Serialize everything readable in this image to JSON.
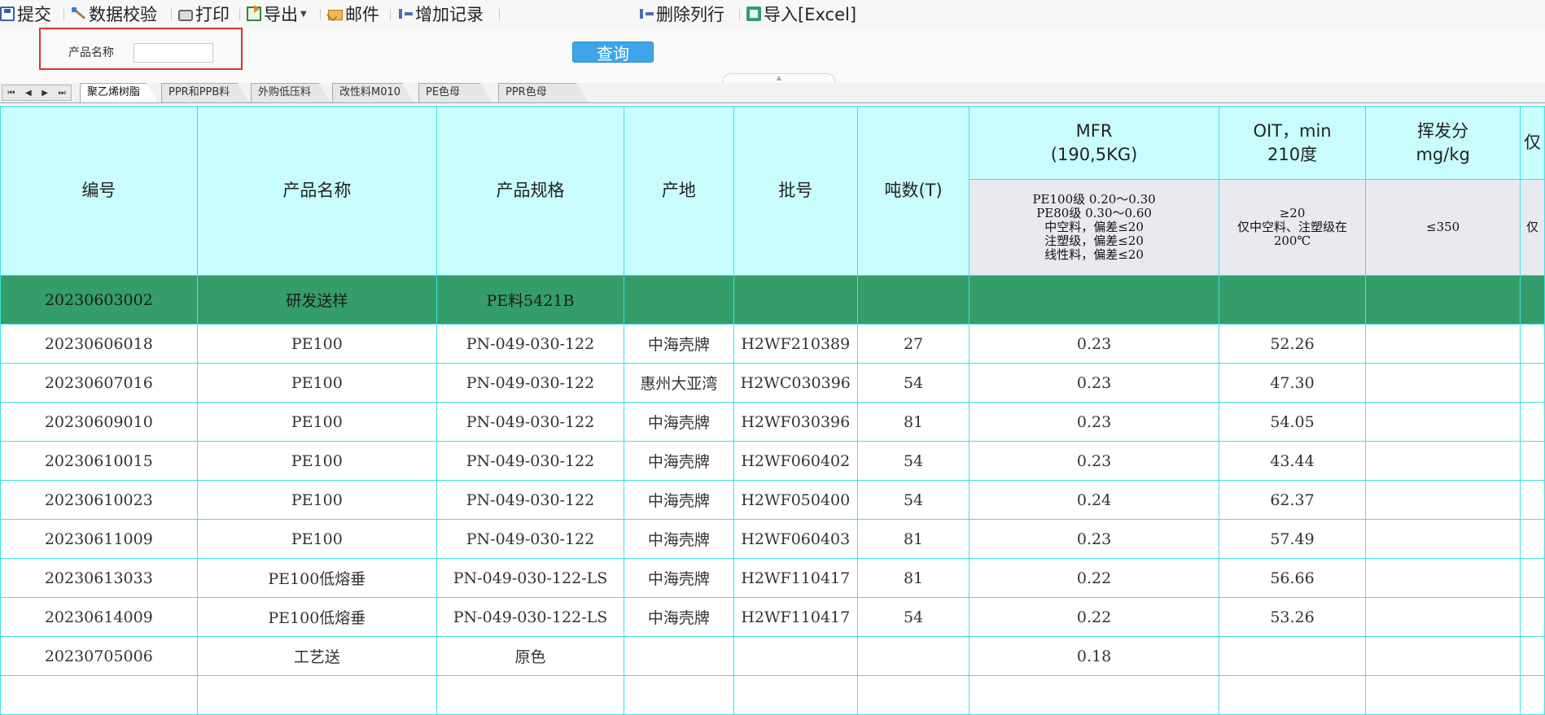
{
  "toolbar": {
    "submit": "提交",
    "validate": "数据校验",
    "print": "打印",
    "export": "导出",
    "mail": "邮件",
    "add_record": "增加记录",
    "delete_row": "删除列行",
    "import_excel": "导入[Excel]"
  },
  "search": {
    "label": "产品名称",
    "value": "",
    "query_button": "查询"
  },
  "tabs": [
    "聚乙烯树脂",
    "PPR和PPB料",
    "外购低压料",
    "改性料M010",
    "PE色母",
    "PPR色母"
  ],
  "table": {
    "headers": {
      "id": "编号",
      "name": "产品名称",
      "spec": "产品规格",
      "origin": "产地",
      "batch": "批号",
      "tons": "吨数(T)",
      "mfr_line1": "MFR",
      "mfr_line2": "(190,5KG)",
      "oit_line1": "OIT，min",
      "oit_line2": "210度",
      "vol_line1": "挥发分",
      "vol_line2": "mg/kg",
      "extra": "仅"
    },
    "subheaders": {
      "mfr": [
        "PE100级 0.20～0.30",
        "PE80级 0.30～0.60",
        "中空料，偏差≤20",
        "注塑级，偏差≤20",
        "线性料，偏差≤20"
      ],
      "oit": [
        "≥20",
        "仅中空料、注塑级在",
        "200℃"
      ],
      "vol": "≤350",
      "extra": "仅"
    },
    "rows": [
      {
        "id": "20230603002",
        "name": "研发送样",
        "spec": "PE料5421B",
        "origin": "",
        "batch": "",
        "tons": "",
        "mfr": "",
        "oit": "",
        "vol": "",
        "extra": "",
        "highlight": true
      },
      {
        "id": "20230606018",
        "name": "PE100",
        "spec": "PN-049-030-122",
        "origin": "中海壳牌",
        "batch": "H2WF210389",
        "tons": "27",
        "mfr": "0.23",
        "oit": "52.26",
        "vol": "",
        "extra": ""
      },
      {
        "id": "20230607016",
        "name": "PE100",
        "spec": "PN-049-030-122",
        "origin": "惠州大亚湾",
        "batch": "H2WC030396",
        "tons": "54",
        "mfr": "0.23",
        "oit": "47.30",
        "vol": "",
        "extra": ""
      },
      {
        "id": "20230609010",
        "name": "PE100",
        "spec": "PN-049-030-122",
        "origin": "中海壳牌",
        "batch": "H2WF030396",
        "tons": "81",
        "mfr": "0.23",
        "oit": "54.05",
        "vol": "",
        "extra": ""
      },
      {
        "id": "20230610015",
        "name": "PE100",
        "spec": "PN-049-030-122",
        "origin": "中海壳牌",
        "batch": "H2WF060402",
        "tons": "54",
        "mfr": "0.23",
        "oit": "43.44",
        "vol": "",
        "extra": ""
      },
      {
        "id": "20230610023",
        "name": "PE100",
        "spec": "PN-049-030-122",
        "origin": "中海壳牌",
        "batch": "H2WF050400",
        "tons": "54",
        "mfr": "0.24",
        "oit": "62.37",
        "vol": "",
        "extra": ""
      },
      {
        "id": "20230611009",
        "name": "PE100",
        "spec": "PN-049-030-122",
        "origin": "中海壳牌",
        "batch": "H2WF060403",
        "tons": "81",
        "mfr": "0.23",
        "oit": "57.49",
        "vol": "",
        "extra": ""
      },
      {
        "id": "20230613033",
        "name": "PE100低熔垂",
        "spec": "PN-049-030-122-LS",
        "origin": "中海壳牌",
        "batch": "H2WF110417",
        "tons": "81",
        "mfr": "0.22",
        "oit": "56.66",
        "vol": "",
        "extra": ""
      },
      {
        "id": "20230614009",
        "name": "PE100低熔垂",
        "spec": "PN-049-030-122-LS",
        "origin": "中海壳牌",
        "batch": "H2WF110417",
        "tons": "54",
        "mfr": "0.22",
        "oit": "53.26",
        "vol": "",
        "extra": ""
      },
      {
        "id": "20230705006",
        "name": "工艺送",
        "spec": "原色",
        "origin": "",
        "batch": "",
        "tons": "",
        "mfr": "0.18",
        "oit": "",
        "vol": "",
        "extra": ""
      },
      {
        "id": "",
        "name": "",
        "spec": "",
        "origin": "",
        "batch": "",
        "tons": "",
        "mfr": "",
        "oit": "",
        "vol": "",
        "extra": ""
      }
    ]
  }
}
